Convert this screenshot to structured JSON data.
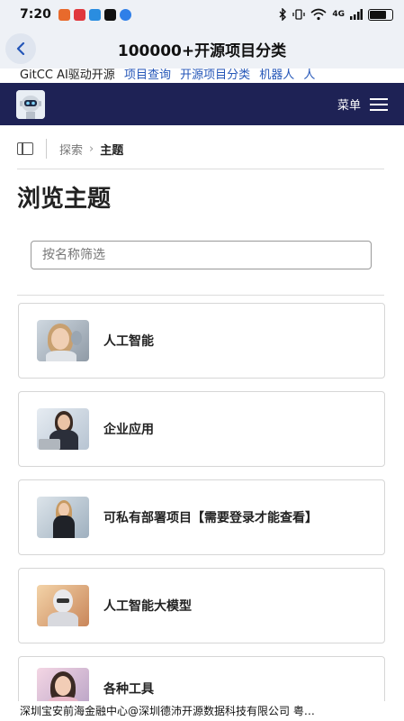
{
  "status_bar": {
    "time": "7:20",
    "apps": [
      "#e86a2c",
      "#e0383e",
      "#2a8de0",
      "#111111",
      "#2f7fe8"
    ],
    "right_text": "4G",
    "battery_level": 0.7
  },
  "title_bar": {
    "back_icon": "chevron-left-icon",
    "title": "100000+开源项目分类"
  },
  "ticker": {
    "items": [
      {
        "text": "GitCC AI驱动开源",
        "type": "plain"
      },
      {
        "text": "项目查询",
        "type": "link"
      },
      {
        "text": "开源项目分类",
        "type": "link"
      },
      {
        "text": "机器人",
        "type": "link"
      },
      {
        "text": "人",
        "type": "link"
      }
    ]
  },
  "nav": {
    "logo_icon": "robot-logo-icon",
    "menu_label": "菜单",
    "menu_icon": "hamburger-icon",
    "bg_color": "#1e2255"
  },
  "breadcrumb": {
    "parent": "探索",
    "separator": "›",
    "current": "主题"
  },
  "page": {
    "heading": "浏览主题",
    "filter_placeholder": "按名称筛选",
    "filter_value": ""
  },
  "topics": [
    {
      "label": "人工智能",
      "thumb": "ai-robot-woman-thumbnail"
    },
    {
      "label": "企业应用",
      "thumb": "business-woman-laptop-thumbnail"
    },
    {
      "label": "可私有部署项目【需要登录才能查看】",
      "thumb": "woman-in-office-thumbnail"
    },
    {
      "label": "人工智能大模型",
      "thumb": "humanoid-robot-thumbnail"
    },
    {
      "label": "各种工具",
      "thumb": "woman-portrait-thumbnail"
    }
  ],
  "footer": {
    "text": "深圳宝安前海金融中心@深圳德沛开源数据科技有限公司 粤…"
  }
}
